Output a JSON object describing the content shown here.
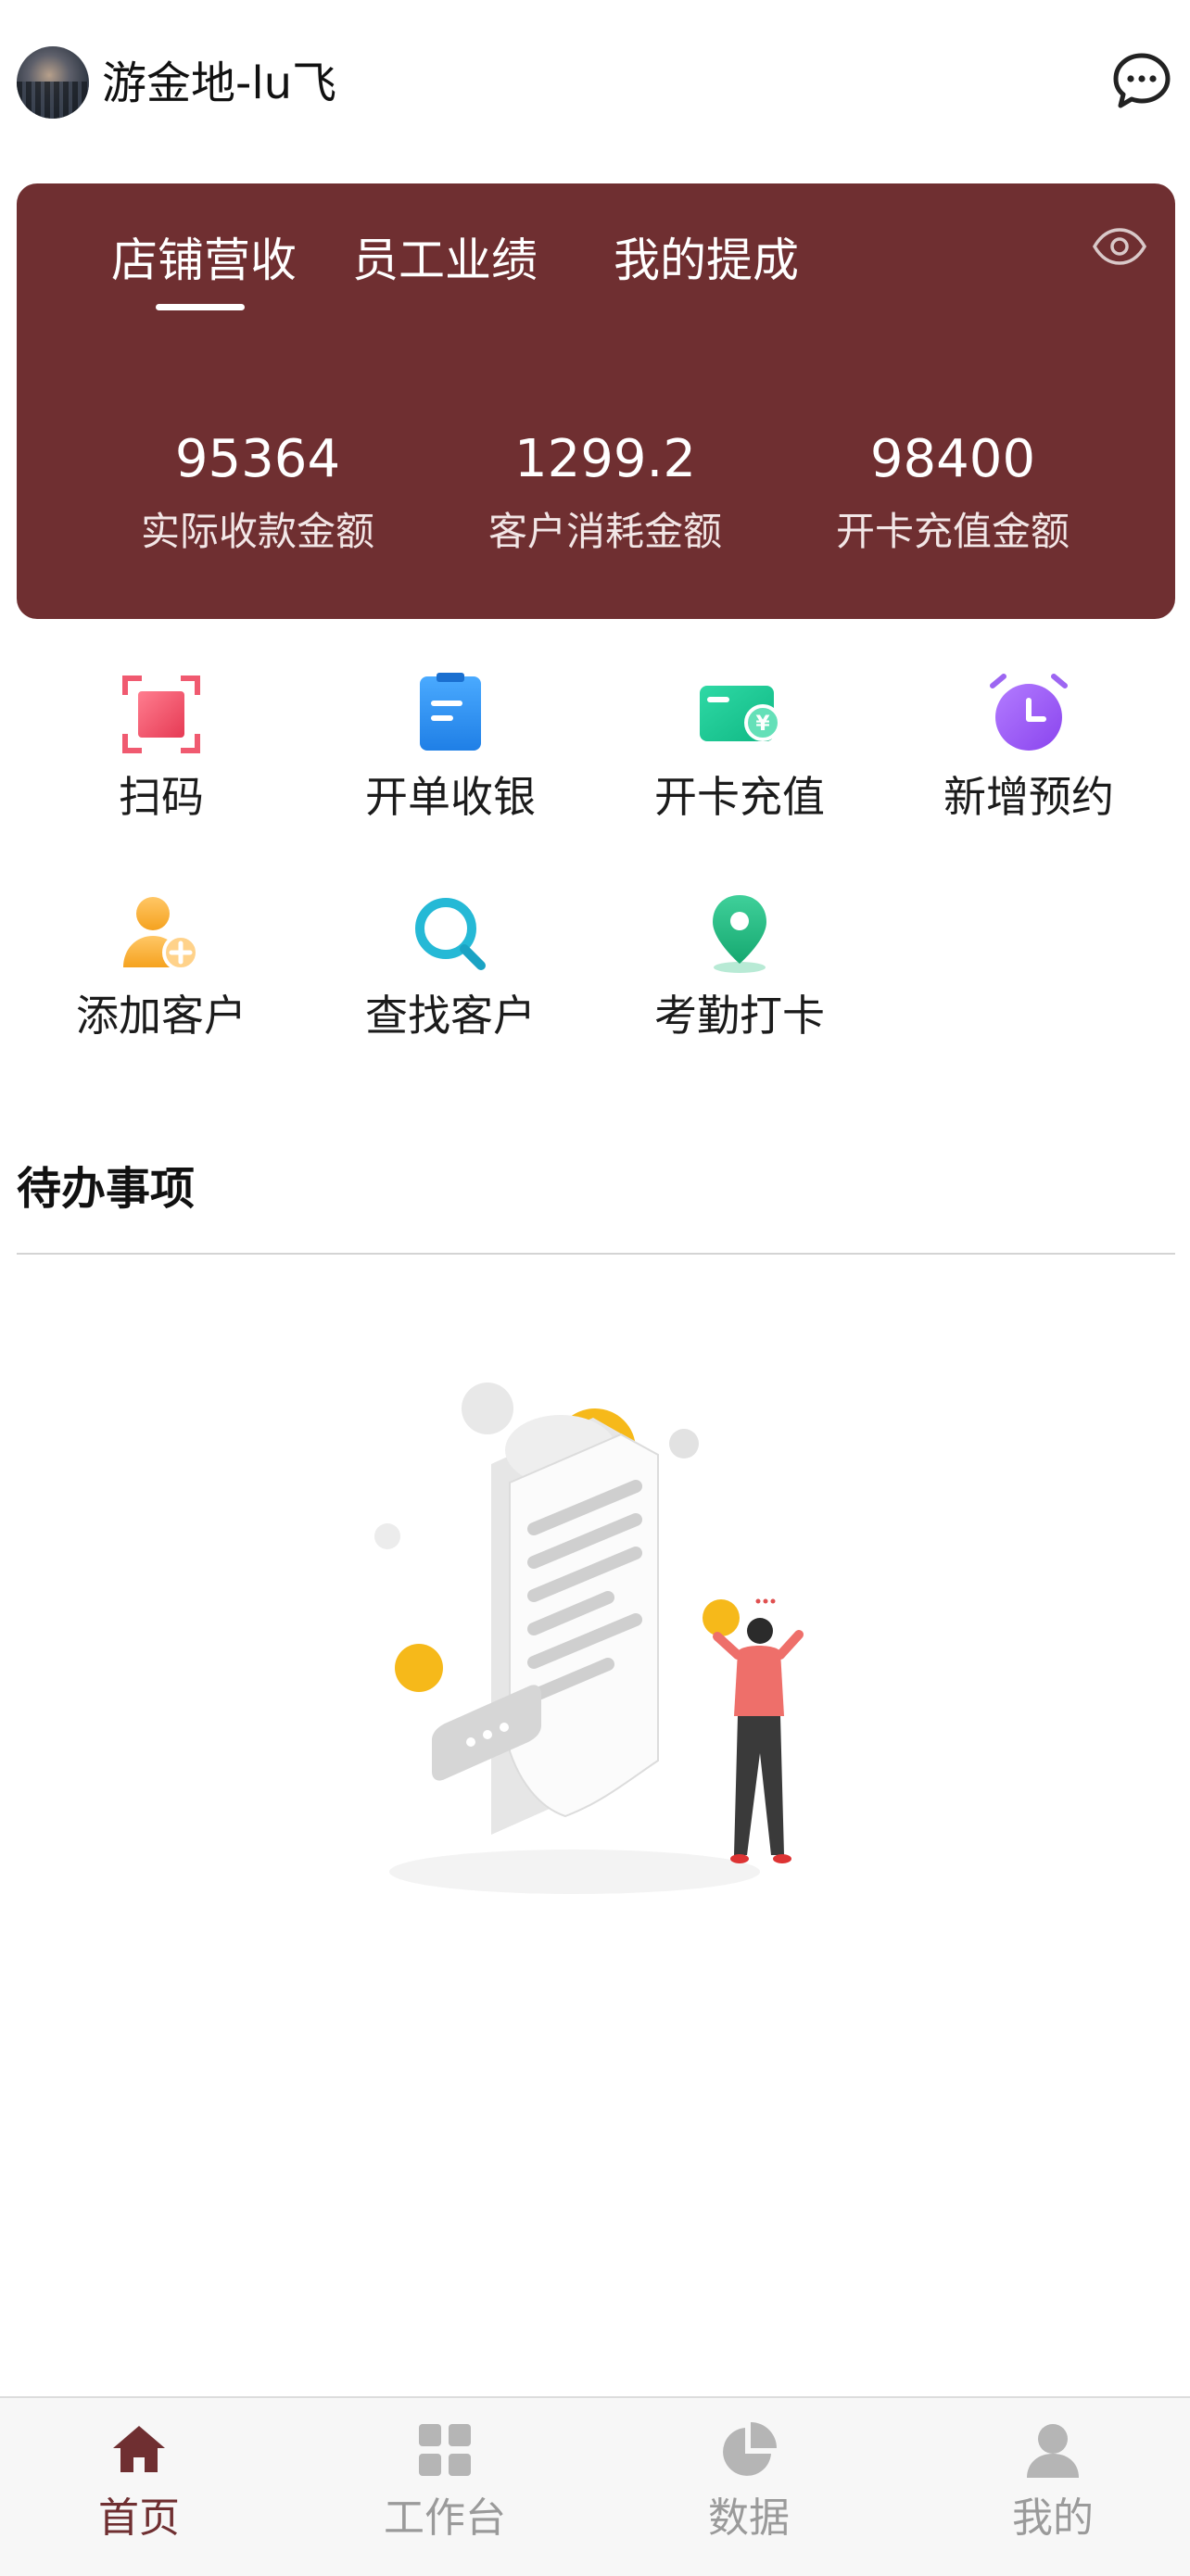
{
  "header": {
    "username": "游金地-lu飞"
  },
  "revenue_card": {
    "tabs": [
      "店铺营收",
      "员工业绩",
      "我的提成"
    ],
    "active_tab": "店铺营收",
    "stats": [
      {
        "value": "95364",
        "label": "实际收款金额"
      },
      {
        "value": "1299.2",
        "label": "客户消耗金额"
      },
      {
        "value": "98400",
        "label": "开卡充值金额"
      }
    ]
  },
  "quick_actions": [
    {
      "label": "扫码",
      "icon": "scan-icon"
    },
    {
      "label": "开单收银",
      "icon": "document-icon"
    },
    {
      "label": "开卡充值",
      "icon": "card-recharge-icon"
    },
    {
      "label": "新增预约",
      "icon": "alarm-clock-icon"
    },
    {
      "label": "添加客户",
      "icon": "add-user-icon"
    },
    {
      "label": "查找客户",
      "icon": "search-icon"
    },
    {
      "label": "考勤打卡",
      "icon": "location-pin-icon"
    }
  ],
  "todo": {
    "title": "待办事项"
  },
  "tabbar": [
    {
      "label": "首页",
      "icon": "home-icon",
      "active": true
    },
    {
      "label": "工作台",
      "icon": "grid-icon",
      "active": false
    },
    {
      "label": "数据",
      "icon": "pie-chart-icon",
      "active": false
    },
    {
      "label": "我的",
      "icon": "user-icon",
      "active": false
    }
  ],
  "colors": {
    "brand": "#6f2f31",
    "tab_inactive": "#9a9a9a"
  }
}
